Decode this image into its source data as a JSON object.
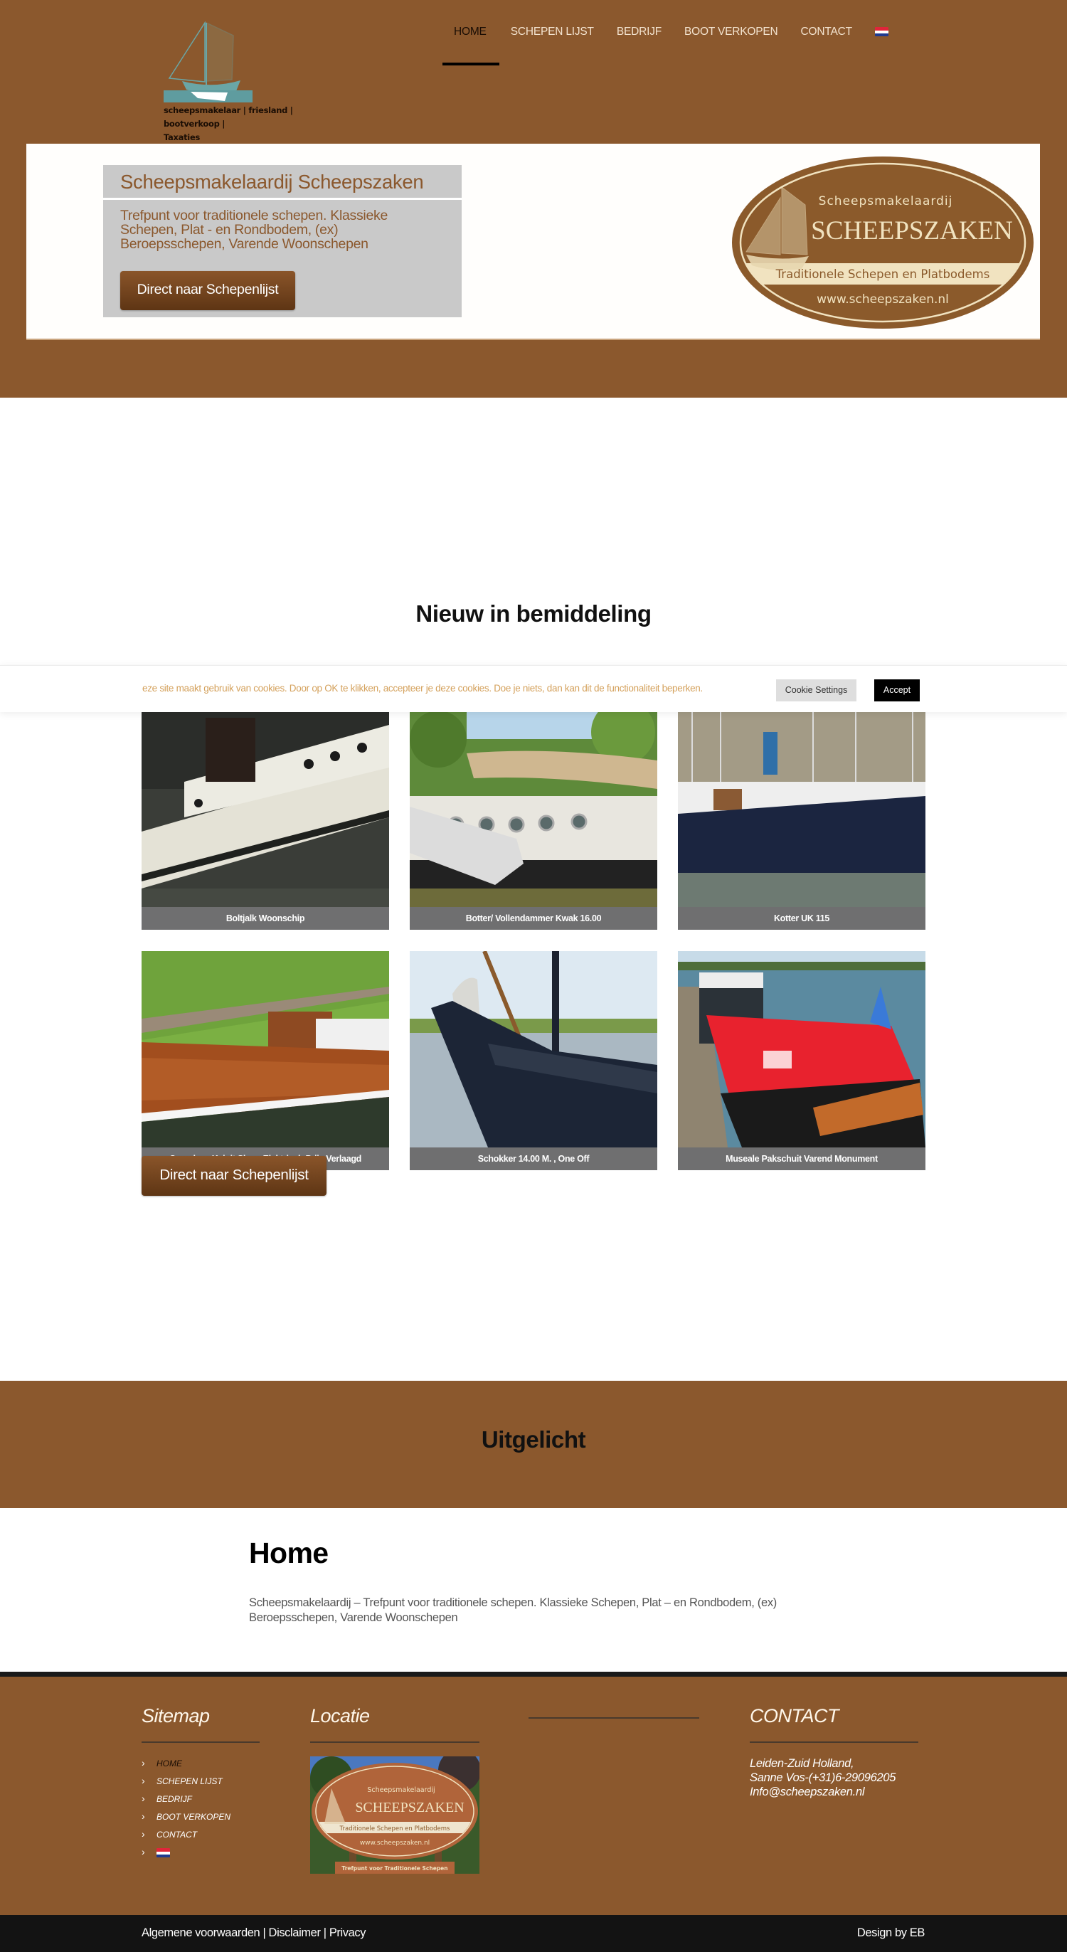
{
  "header": {
    "logo_tagline_line1": "scheepsmakelaar | friesland | bootverkoop |",
    "logo_tagline_line2": "Taxaties",
    "nav": [
      {
        "label": "HOME",
        "active": true
      },
      {
        "label": "SCHEPEN LIJST",
        "active": false
      },
      {
        "label": "BEDRIJF",
        "active": false
      },
      {
        "label": "BOOT VERKOPEN",
        "active": false
      },
      {
        "label": "CONTACT",
        "active": false
      }
    ],
    "language_flag": "netherlands-flag-icon"
  },
  "hero": {
    "title": "Scheepsmakelaardij Scheepszaken",
    "text": "Trefpunt voor traditionele schepen. Klassieke Schepen, Plat - en Rondbodem, (ex) Beroepsschepen, Varende Woonschepen",
    "button_label": "Direct naar Schepenlijst",
    "emblem": {
      "top_line": "Scheepsmakelaardij",
      "name": "SCHEEPSZAKEN",
      "band": "Traditionele Schepen en Platbodems",
      "url": "www.scheepszaken.nl"
    }
  },
  "cookie": {
    "text": "eze site maakt gebruik van cookies. Door op OK te klikken, accepteer je deze cookies. Doe je niets, dan kan dit de functionaliteit beperken.",
    "settings_label": "Cookie Settings",
    "accept_label": "Accept"
  },
  "new_listings": {
    "title": "Nieuw in bemiddeling",
    "items": [
      {
        "caption": "Boltjalk Woonschip"
      },
      {
        "caption": "Botter/ Vollendammer Kwak 16.00"
      },
      {
        "caption": "Kotter UK 115"
      },
      {
        "caption": "Canadese Kajuit Sloep Elektrisch Prijs Verlaagd"
      },
      {
        "caption": "Schokker 14.00 M. , One Off"
      },
      {
        "caption": "Museale Pakschuit Varend Monument"
      }
    ],
    "button_label": "Direct naar Schepenlijst"
  },
  "featured": {
    "band_title": "Uitgelicht",
    "heading": "Home",
    "text": "Scheepsmakelaardij – Trefpunt voor traditionele schepen. Klassieke Schepen, Plat – en Rondbodem, (ex) Beroepsschepen, Varende Woonschepen"
  },
  "footer": {
    "sitemap_title": "Sitemap",
    "sitemap_items": [
      "HOME",
      "SCHEPEN LIJST",
      "BEDRIJF",
      "BOOT VERKOPEN",
      "CONTACT"
    ],
    "locatie_title": "Locatie",
    "locatie_sign": {
      "top_line": "Scheepsmakelaardij",
      "name": "SCHEEPSZAKEN",
      "band": "Traditionele Schepen en Platbodems",
      "url": "www.scheepszaken.nl",
      "plaque": "Trefpunt voor Traditionele Schepen"
    },
    "contact_title": "CONTACT",
    "contact_lines": [
      "Leiden-Zuid Holland,",
      "Sanne Vos-(+31)6-29096205",
      "Info@scheepszaken.nl"
    ],
    "legal_links": [
      "Algemene voorwaarden",
      "Disclaimer",
      "Privacy"
    ],
    "legal_separator": " | ",
    "credit": "Design by EB"
  },
  "colors": {
    "brand_brown": "#8b582d",
    "cookie_text": "#d4a15c",
    "caption_gray": "#6f6f70",
    "bottom_bar": "#131313"
  }
}
